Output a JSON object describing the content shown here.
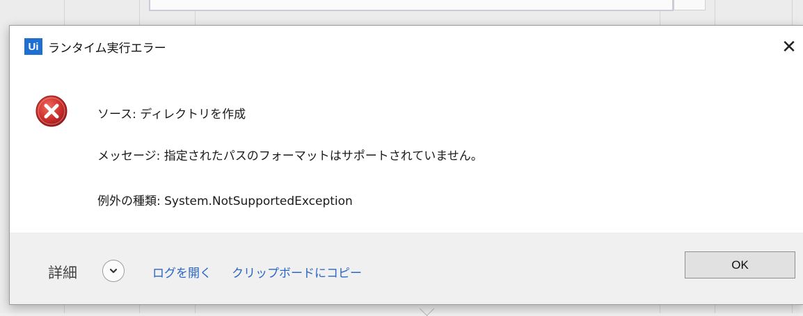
{
  "dialog": {
    "app_icon_text": "Ui",
    "title": "ランタイム実行エラー",
    "close_glyph": "✕",
    "source": "ソース: ディレクトリを作成",
    "message": "メッセージ: 指定されたパスのフォーマットはサポートされていません。",
    "exception": "例外の種類: System.NotSupportedException",
    "icon": "error-icon"
  },
  "footer": {
    "details_label": "詳細",
    "details_toggle_icon": "chevron-down-icon",
    "open_log": "ログを開く",
    "copy_clipboard": "クリップボードにコピー",
    "ok": "OK"
  },
  "colors": {
    "accent_link": "#2a66c8",
    "error_red": "#c9262a",
    "app_icon_blue": "#1f6fd1"
  }
}
